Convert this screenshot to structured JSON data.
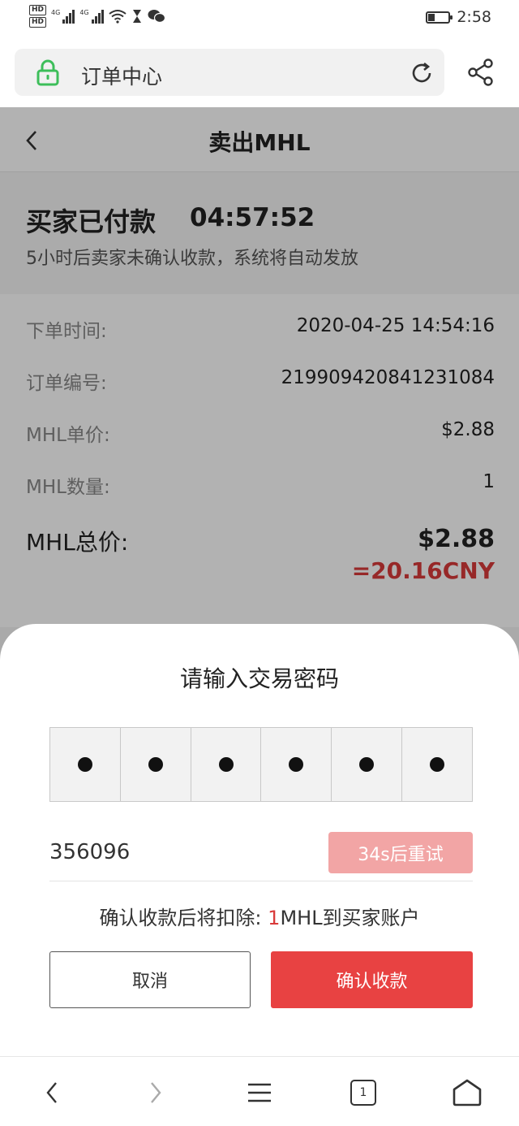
{
  "status_bar": {
    "time": "2:58",
    "hd1": "HD",
    "hd2": "HD",
    "net1": "4G",
    "net2": "4G"
  },
  "browser": {
    "url_title": "订单中心"
  },
  "page": {
    "title": "卖出MHL",
    "status": "买家已付款",
    "countdown": "04:57:52",
    "status_desc": "5小时后卖家未确认收款，系统将自动发放",
    "rows": [
      {
        "label": "下单时间:",
        "value": "2020-04-25 14:54:16"
      },
      {
        "label": "订单编号:",
        "value": "219909420841231084"
      },
      {
        "label": "MHL单价:",
        "value": "$2.88"
      },
      {
        "label": "MHL数量:",
        "value": "1"
      }
    ],
    "total_label": "MHL总价:",
    "total_value": "$2.88",
    "total_cny": "=20.16CNY"
  },
  "sheet": {
    "title": "请输入交易密码",
    "code_value": "356096",
    "retry_label": "34s后重试",
    "deduct_prefix": "确认收款后将扣除: ",
    "deduct_amount": "1",
    "deduct_suffix": "MHL到买家账户",
    "cancel_label": "取消",
    "confirm_label": "确认收款"
  },
  "nav": {
    "tab_count": "1"
  },
  "icons": [
    "lock-icon",
    "reload-icon",
    "share-icon",
    "back-icon",
    "nav-back-icon",
    "nav-forward-icon",
    "menu-icon",
    "tabs-icon",
    "home-icon"
  ],
  "colors": {
    "accent_red": "#e84242",
    "retry_pink": "#f2a5a5",
    "lock_green": "#3dbe5a",
    "price_red": "#d93a3a"
  }
}
